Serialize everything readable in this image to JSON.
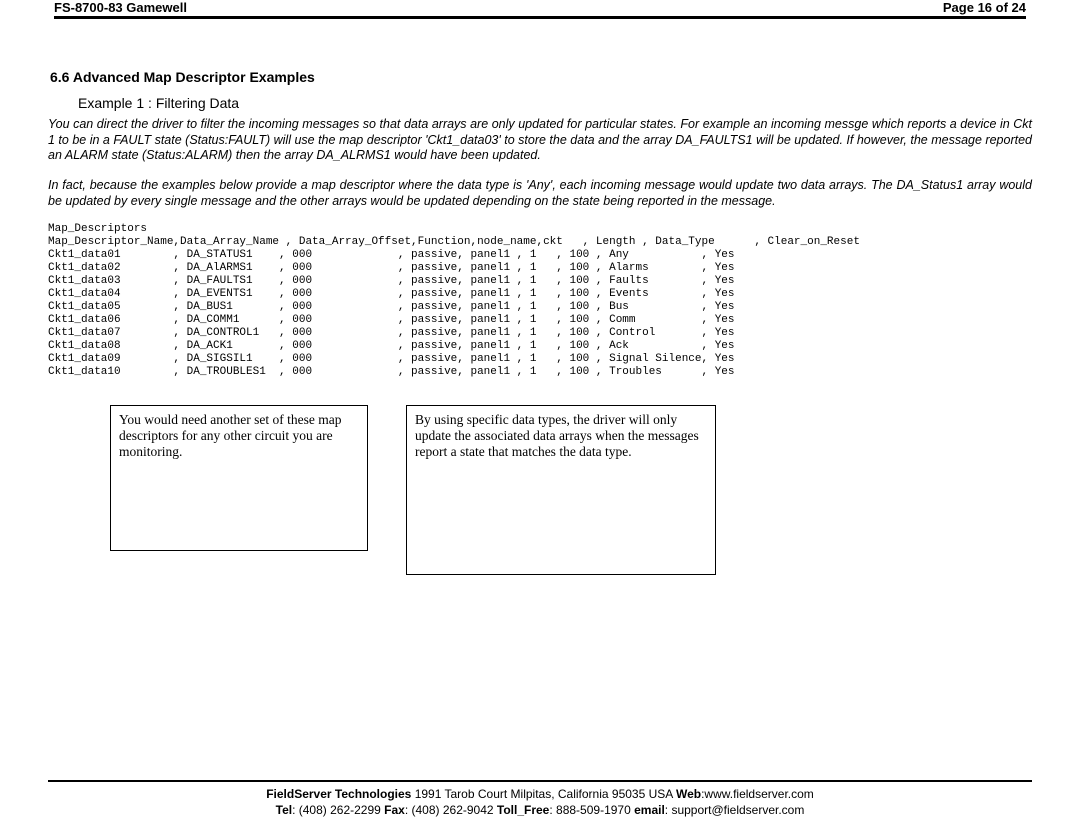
{
  "header": {
    "left": "FS-8700-83 Gamewell",
    "right": "Page 16 of 24"
  },
  "section_number": "6.6",
  "section_title": "Advanced Map Descriptor Examples",
  "example_title": "Example 1 : Filtering Data",
  "para1": "You can direct the driver to filter the incoming messages so that data arrays are only updated for particular states. For example an incoming messge which reports a device in Ckt 1 to be in a FAULT state (Status:FAULT) will use the map descriptor 'Ckt1_data03' to store the data and the array DA_FAULTS1 will be updated. If however, the message reported an ALARM state (Status:ALARM) then the array DA_ALRMS1 would have been updated.",
  "para2": "In fact, because the examples below provide a map descriptor where the data type is 'Any', each incoming message would update two data arrays. The DA_Status1 array would be updated by every single message and the other arrays would be updated depending on the state being reported in the message.",
  "table": {
    "block_label": "Map_Descriptors",
    "headers": [
      "Map_Descriptor_Name",
      "Data_Array_Name",
      "Data_Array_Offset",
      "Function",
      "node_name",
      "ckt",
      "Length",
      "Data_Type",
      "Clear_on_Reset"
    ],
    "rows": [
      [
        "Ckt1_data01",
        "DA_STATUS1",
        "000",
        "passive",
        "panel1",
        "1",
        "100",
        "Any",
        "Yes"
      ],
      [
        "Ckt1_data02",
        "DA_AlARMS1",
        "000",
        "passive",
        "panel1",
        "1",
        "100",
        "Alarms",
        "Yes"
      ],
      [
        "Ckt1_data03",
        "DA_FAULTS1",
        "000",
        "passive",
        "panel1",
        "1",
        "100",
        "Faults",
        "Yes"
      ],
      [
        "Ckt1_data04",
        "DA_EVENTS1",
        "000",
        "passive",
        "panel1",
        "1",
        "100",
        "Events",
        "Yes"
      ],
      [
        "Ckt1_data05",
        "DA_BUS1",
        "000",
        "passive",
        "panel1",
        "1",
        "100",
        "Bus",
        "Yes"
      ],
      [
        "Ckt1_data06",
        "DA_COMM1",
        "000",
        "passive",
        "panel1",
        "1",
        "100",
        "Comm",
        "Yes"
      ],
      [
        "Ckt1_data07",
        "DA_CONTROL1",
        "000",
        "passive",
        "panel1",
        "1",
        "100",
        "Control",
        "Yes"
      ],
      [
        "Ckt1_data08",
        "DA_ACK1",
        "000",
        "passive",
        "panel1",
        "1",
        "100",
        "Ack",
        "Yes"
      ],
      [
        "Ckt1_data09",
        "DA_SIGSIL1",
        "000",
        "passive",
        "panel1",
        "1",
        "100",
        "Signal Silence",
        "Yes"
      ],
      [
        "Ckt1_data10",
        "DA_TROUBLES1",
        "000",
        "passive",
        "panel1",
        "1",
        "100",
        "Troubles",
        "Yes"
      ]
    ]
  },
  "callout_left": "You would need another set of these map descriptors for any other circuit you are monitoring.",
  "callout_right": "By using specific data types, the driver will only update the associated data arrays when the messages report a state that matches the data type.",
  "footer": {
    "line1_a": "FieldServer Technologies",
    "line1_b": " 1991 Tarob Court Milpitas, California 95035 USA  ",
    "line1_c": "Web",
    "line1_d": ":www.fieldserver.com",
    "line2_a": "Tel",
    "line2_b": ": (408) 262-2299  ",
    "line2_c": "Fax",
    "line2_d": ": (408) 262-9042  ",
    "line2_e": "Toll_Free",
    "line2_f": ": 888-509-1970  ",
    "line2_g": "email",
    "line2_h": ": support@fieldserver.com"
  }
}
